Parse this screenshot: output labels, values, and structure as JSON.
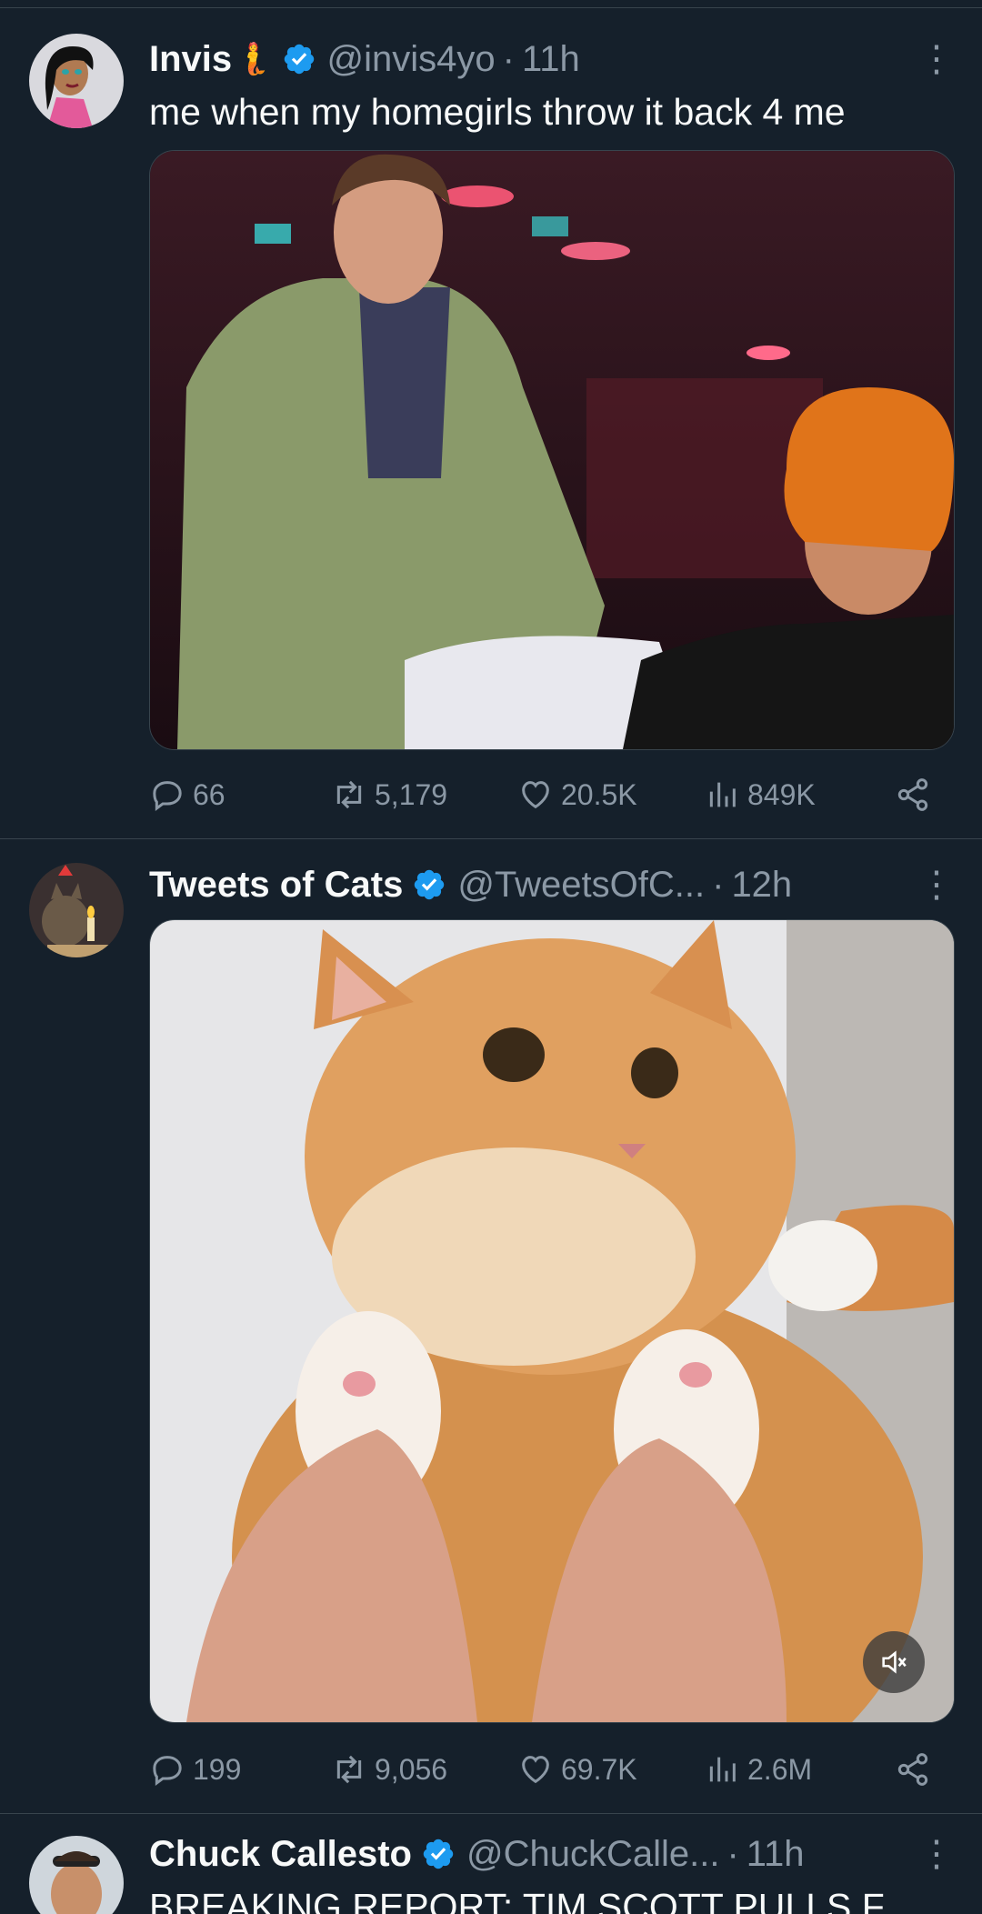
{
  "tweets": [
    {
      "name": "Invis",
      "handle": "@invis4yo",
      "time": "11h",
      "text": "me when my homegirls throw it back 4 me",
      "stats": {
        "replies": "66",
        "retweets": "5,179",
        "likes": "20.5K",
        "views": "849K"
      }
    },
    {
      "name": "Tweets of Cats",
      "handle": "@TweetsOfC...",
      "time": "12h",
      "text": "",
      "stats": {
        "replies": "199",
        "retweets": "9,056",
        "likes": "69.7K",
        "views": "2.6M"
      }
    },
    {
      "name": "Chuck Callesto",
      "handle": "@ChuckCalle...",
      "time": "11h",
      "text": "BREAKING REPORT: Tim Scott pulls f"
    }
  ],
  "icons": {
    "verified": "verified-badge-icon",
    "reply": "reply-icon",
    "retweet": "retweet-icon",
    "like": "heart-icon",
    "views": "views-icon",
    "share": "share-icon",
    "mute": "mute-icon",
    "more": "more-icon"
  },
  "colors": {
    "background": "#15202b",
    "accent": "#1d9bf0",
    "secondary": "#8b98a5",
    "divider": "#38444d"
  }
}
